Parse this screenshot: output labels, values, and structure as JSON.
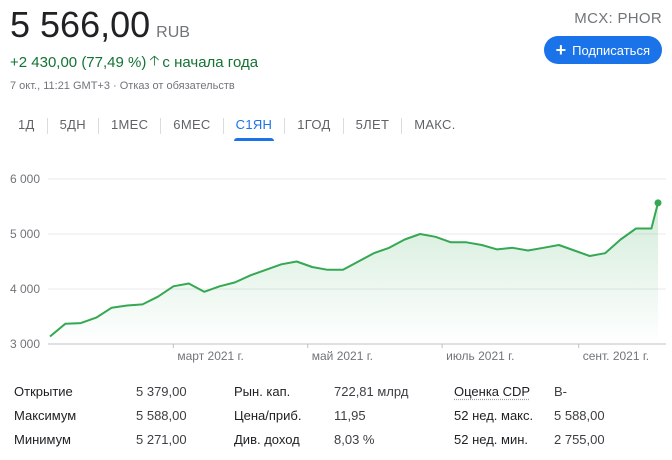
{
  "quote": {
    "price": "5 566,00",
    "currency": "RUB",
    "change": "+2 430,00 (77,49 %)",
    "change_suffix": "с начала года",
    "timestamp": "7 окт., 11:21 GMT+3 · Отказ от обязательств",
    "exchange": "MCX: PHOR"
  },
  "subscribe_label": "Подписаться",
  "icons": {
    "subscribe": "plus-icon",
    "change": "arrow-up-icon"
  },
  "colors": {
    "accent": "#1a73e8",
    "positive": "#137333",
    "line": "#34a853"
  },
  "tabs": [
    {
      "label": "1Д",
      "active": false
    },
    {
      "label": "5ДН",
      "active": false
    },
    {
      "label": "1МЕС",
      "active": false
    },
    {
      "label": "6МЕС",
      "active": false
    },
    {
      "label": "С1ЯН",
      "active": true
    },
    {
      "label": "1ГОД",
      "active": false
    },
    {
      "label": "5ЛЕТ",
      "active": false
    },
    {
      "label": "МАКС.",
      "active": false
    }
  ],
  "chart_data": {
    "type": "area",
    "title": "",
    "xlabel": "",
    "ylabel": "",
    "ylim": [
      3000,
      6000
    ],
    "y_ticks": [
      "6 000",
      "5 000",
      "4 000",
      "3 000"
    ],
    "x_ticks": [
      "март 2021 г.",
      "май 2021 г.",
      "июль 2021 г.",
      "сент. 2021 г."
    ],
    "grid": true,
    "x": [
      "2021-01-04",
      "2021-01-11",
      "2021-01-18",
      "2021-01-25",
      "2021-02-01",
      "2021-02-08",
      "2021-02-15",
      "2021-02-22",
      "2021-03-01",
      "2021-03-08",
      "2021-03-15",
      "2021-03-22",
      "2021-03-29",
      "2021-04-05",
      "2021-04-12",
      "2021-04-19",
      "2021-04-26",
      "2021-05-03",
      "2021-05-10",
      "2021-05-17",
      "2021-05-24",
      "2021-05-31",
      "2021-06-07",
      "2021-06-14",
      "2021-06-21",
      "2021-06-28",
      "2021-07-05",
      "2021-07-12",
      "2021-07-19",
      "2021-07-26",
      "2021-08-02",
      "2021-08-09",
      "2021-08-16",
      "2021-08-23",
      "2021-08-30",
      "2021-09-06",
      "2021-09-13",
      "2021-09-20",
      "2021-09-27",
      "2021-10-04",
      "2021-10-07"
    ],
    "values": [
      3136,
      3370,
      3380,
      3480,
      3660,
      3700,
      3720,
      3860,
      4050,
      4100,
      3950,
      4050,
      4120,
      4250,
      4350,
      4450,
      4500,
      4400,
      4350,
      4350,
      4500,
      4650,
      4750,
      4900,
      5000,
      4950,
      4850,
      4850,
      4800,
      4720,
      4750,
      4700,
      4750,
      4800,
      4700,
      4600,
      4650,
      4900,
      5100,
      5100,
      5566
    ]
  },
  "stats": [
    {
      "label": "Открытие",
      "value": "5 379,00"
    },
    {
      "label": "Рын. кап.",
      "value": "722,81 млрд"
    },
    {
      "label": "Оценка CDP",
      "value": "B-"
    },
    {
      "label": "Максимум",
      "value": "5 588,00"
    },
    {
      "label": "Цена/приб.",
      "value": "11,95"
    },
    {
      "label": "52 нед. макс.",
      "value": "5 588,00"
    },
    {
      "label": "Минимум",
      "value": "5 271,00"
    },
    {
      "label": "Див. доход",
      "value": "8,03 %"
    },
    {
      "label": "52 нед. мин.",
      "value": "2 755,00"
    }
  ]
}
